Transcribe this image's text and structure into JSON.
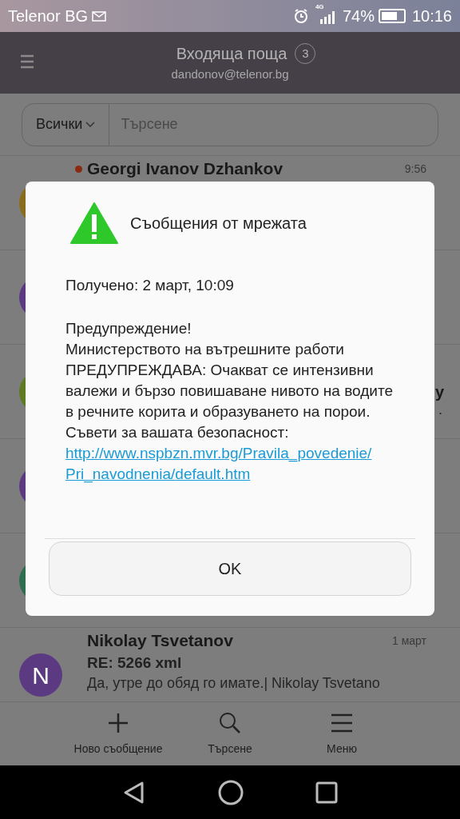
{
  "status_bar": {
    "carrier": "Telenor BG",
    "network": "4G",
    "battery": "74%",
    "time": "10:16"
  },
  "header": {
    "title": "Входяща поща",
    "unread_count": "3",
    "account": "dandonov@telenor.bg"
  },
  "filter": {
    "value": "Всички",
    "search_placeholder": "Търсене"
  },
  "messages": [
    {
      "sender": "Georgi Ivanov Dzhankov",
      "time": "9:56",
      "unread": true,
      "color": "#8a6d1c"
    },
    {
      "color": "#5b3a82"
    },
    {
      "color": "#5e7a22",
      "sender_tail": "y",
      "preview_tail": "."
    },
    {
      "color": "#5b3a82"
    },
    {
      "color": "#2e6e4e"
    },
    {
      "sender": "Nikolay Tsvetanov",
      "time": "1 март",
      "color": "#5b3a82",
      "initial": "N",
      "subject": "RE: 5266 xml",
      "preview": "Да, утре до обяд го имате.| Nikolay Tsvetano"
    }
  ],
  "toolbar": [
    {
      "kind": "compose",
      "label": "Ново съобщение"
    },
    {
      "kind": "search",
      "label": "Търсене"
    },
    {
      "kind": "menu",
      "label": "Меню"
    }
  ],
  "dialog": {
    "title": "Съобщения от мрежата",
    "received": "Получено: 2 март, 10:09",
    "body": "Предупреждение!\nМинистерството на вътрешните работи ПРЕДУПРЕЖДАВА: Очакват се интензивни валежи и бързо повишаване нивото на водите в речните корита и образуването на порои. Съвети за вашата безопасност:",
    "link": "http://www.nspbzn.mvr.bg/Pravila_povedenie/Pri_navodnenia/default.htm",
    "button": "OK"
  }
}
